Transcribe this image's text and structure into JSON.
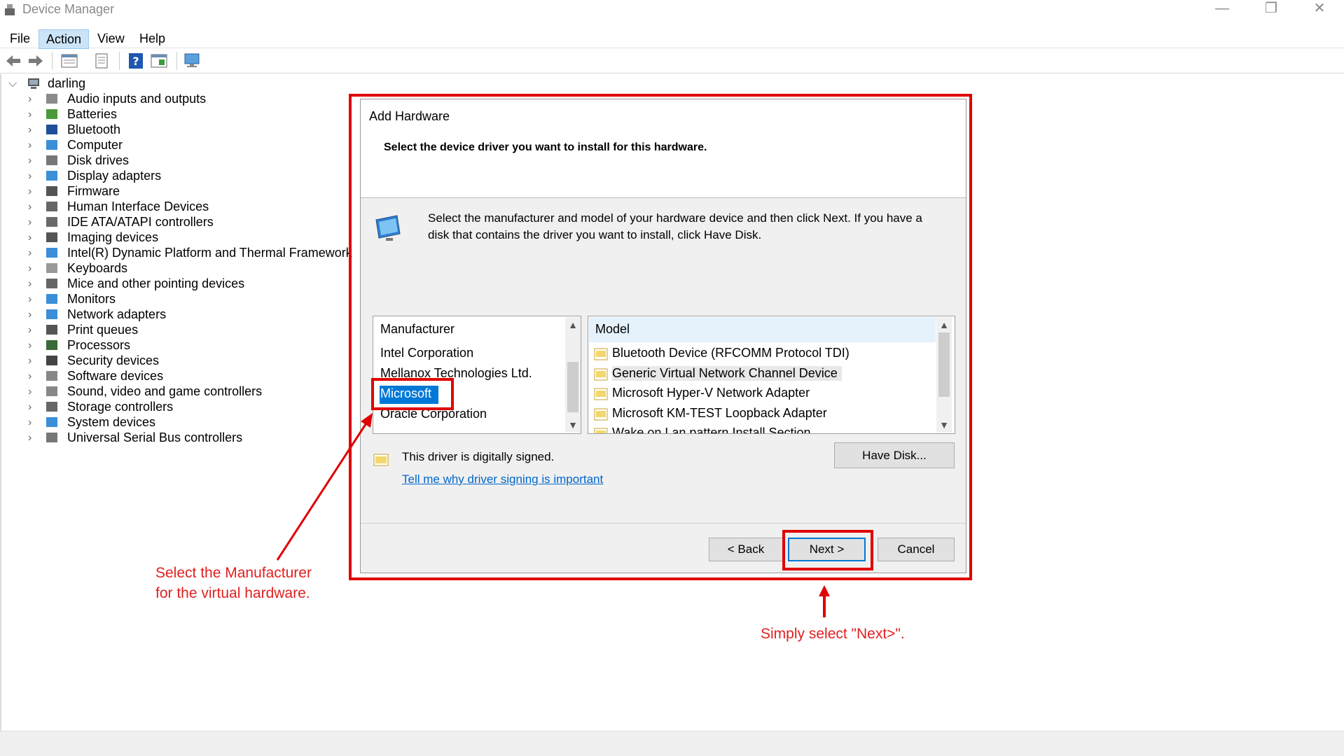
{
  "window": {
    "title": "Device Manager",
    "controls": {
      "minimize": "—",
      "restore": "❐",
      "close": "✕"
    }
  },
  "menu": {
    "file": "File",
    "action": "Action",
    "view": "View",
    "help": "Help"
  },
  "toolbar": {
    "buttons": [
      "back-icon",
      "forward-icon",
      "properties-icon",
      "update-driver-icon",
      "help-icon",
      "show-hidden-icon",
      "scan-hardware-icon"
    ]
  },
  "tree": {
    "root": "darling",
    "items": [
      "Audio inputs and outputs",
      "Batteries",
      "Bluetooth",
      "Computer",
      "Disk drives",
      "Display adapters",
      "Firmware",
      "Human Interface Devices",
      "IDE ATA/ATAPI controllers",
      "Imaging devices",
      "Intel(R) Dynamic Platform and Thermal Framework",
      "Keyboards",
      "Mice and other pointing devices",
      "Monitors",
      "Network adapters",
      "Print queues",
      "Processors",
      "Security devices",
      "Software devices",
      "Sound, video and game controllers",
      "Storage controllers",
      "System devices",
      "Universal Serial Bus controllers"
    ]
  },
  "dialog": {
    "title": "Add Hardware",
    "subtitle": "Select the device driver you want to install for this hardware.",
    "description_line1": "Select the manufacturer and model of your hardware device and then click Next. If you have a",
    "description_line2": "disk that contains the driver you want to install, click Have Disk.",
    "manufacturer": {
      "header": "Manufacturer",
      "items": [
        "Intel Corporation",
        "Mellanox Technologies Ltd.",
        "Microsoft",
        "Oracle Corporation"
      ],
      "selected": "Microsoft"
    },
    "model": {
      "header": "Model",
      "items": [
        "Bluetooth Device (RFCOMM Protocol TDI)",
        "Generic Virtual Network Channel Device",
        "Microsoft Hyper-V Network Adapter",
        "Microsoft KM-TEST Loopback Adapter",
        "Wake on Lan pattern Install Section"
      ]
    },
    "signed_text": "This driver is digitally signed.",
    "signing_link": "Tell me why driver signing is important",
    "have_disk": "Have Disk...",
    "back": "< Back",
    "next": "Next >",
    "cancel": "Cancel"
  },
  "annotations": {
    "left_line1": "Select the Manufacturer",
    "left_line2": "for the virtual hardware.",
    "right": "Simply select \"Next>\"."
  },
  "colors": {
    "annotation": "#e00000",
    "selection": "#0078d7",
    "link": "#0066cc"
  }
}
